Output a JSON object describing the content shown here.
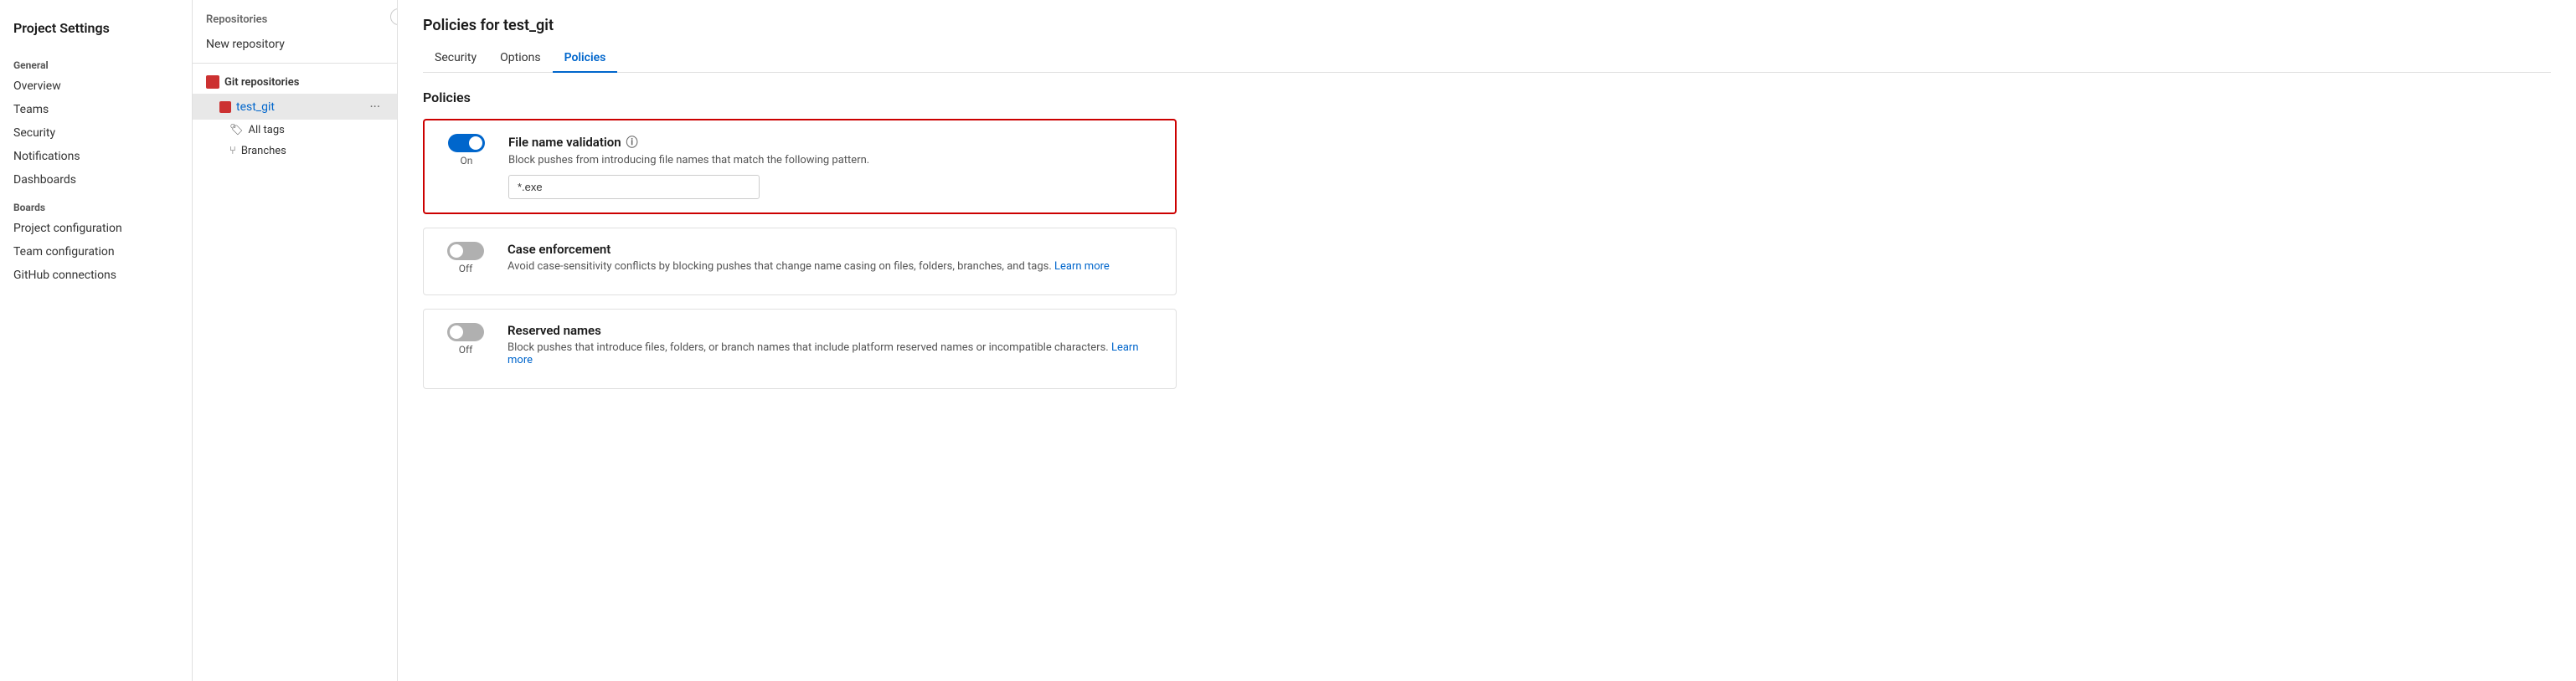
{
  "leftSidebar": {
    "title": "Project Settings",
    "sections": [
      {
        "header": "General",
        "items": [
          {
            "label": "Overview",
            "name": "overview"
          },
          {
            "label": "Teams",
            "name": "teams"
          },
          {
            "label": "Security",
            "name": "security"
          },
          {
            "label": "Notifications",
            "name": "notifications"
          },
          {
            "label": "Dashboards",
            "name": "dashboards"
          }
        ]
      },
      {
        "header": "Boards",
        "items": [
          {
            "label": "Project configuration",
            "name": "project-configuration"
          },
          {
            "label": "Team configuration",
            "name": "team-configuration"
          },
          {
            "label": "GitHub connections",
            "name": "github-connections"
          }
        ]
      }
    ]
  },
  "midSidebar": {
    "title": "Repositories",
    "newRepoLabel": "New repository",
    "repoGroupLabel": "Git repositories",
    "repos": [
      {
        "name": "test_git",
        "active": true,
        "subItems": [
          {
            "label": "All tags",
            "icon": "tag"
          },
          {
            "label": "Branches",
            "icon": "branch"
          }
        ]
      }
    ]
  },
  "mainContent": {
    "pageTitle": "Policies for test_git",
    "tabs": [
      {
        "label": "Security",
        "active": false
      },
      {
        "label": "Options",
        "active": false
      },
      {
        "label": "Policies",
        "active": true
      }
    ],
    "policiesTitle": "Policies",
    "policies": [
      {
        "id": "file-name-validation",
        "name": "File name validation",
        "toggleState": "on",
        "toggleLabel": "On",
        "description": "Block pushes from introducing file names that match the following pattern.",
        "inputValue": "*.exe",
        "inputVisible": true,
        "highlighted": true,
        "learnMore": false
      },
      {
        "id": "case-enforcement",
        "name": "Case enforcement",
        "toggleState": "off",
        "toggleLabel": "Off",
        "description": "Avoid case-sensitivity conflicts by blocking pushes that change name casing on files, folders, branches, and tags.",
        "inputVisible": false,
        "highlighted": false,
        "learnMore": true,
        "learnMoreText": "Learn more"
      },
      {
        "id": "reserved-names",
        "name": "Reserved names",
        "toggleState": "off",
        "toggleLabel": "Off",
        "description": "Block pushes that introduce files, folders, or branch names that include platform reserved names or incompatible characters.",
        "inputVisible": false,
        "highlighted": false,
        "learnMore": true,
        "learnMoreText": "Learn more"
      }
    ]
  },
  "icons": {
    "collapse": "‹",
    "moreOptions": "···",
    "tag": "🏷",
    "branch": "⑂",
    "info": "ⓘ"
  }
}
